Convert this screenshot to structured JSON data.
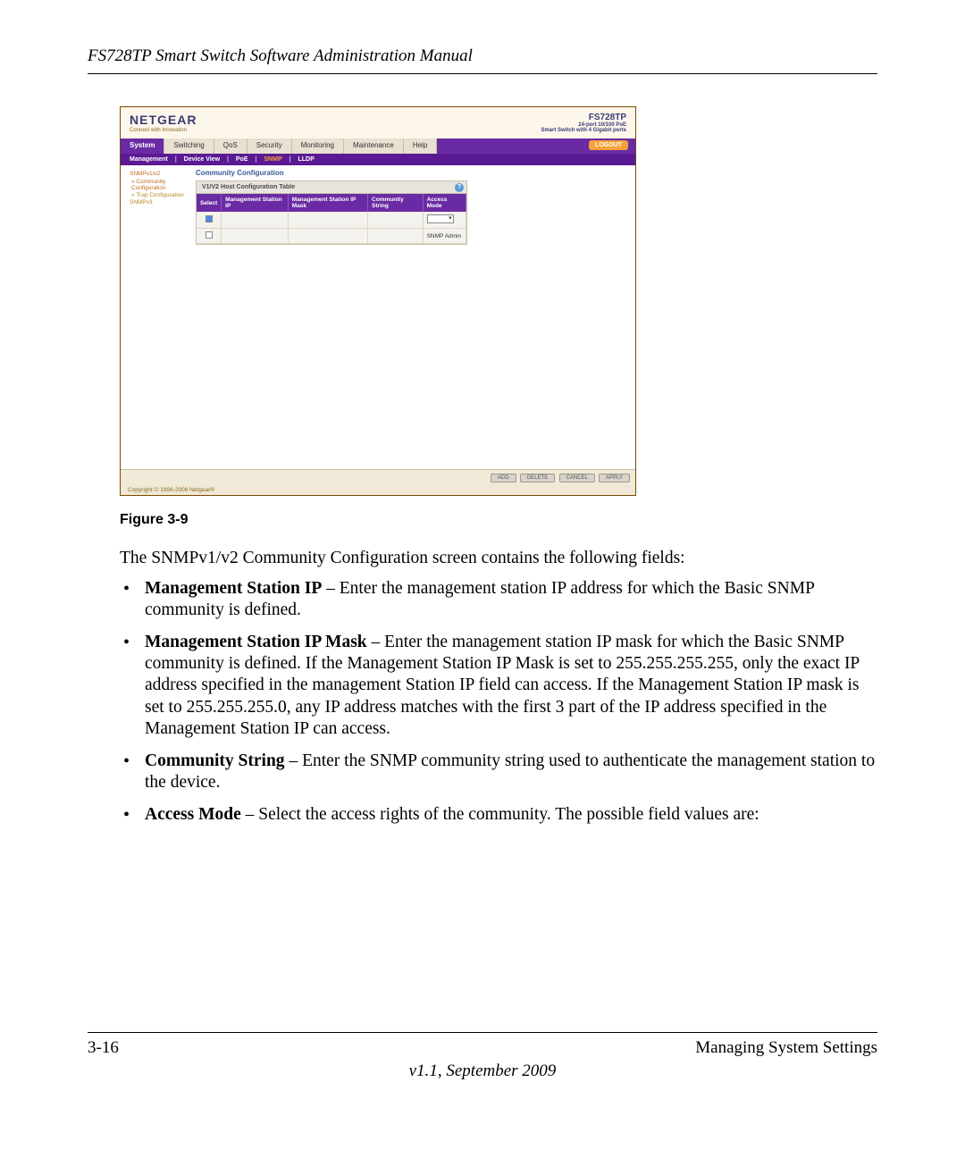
{
  "doc_header": "FS728TP Smart Switch Software Administration Manual",
  "screenshot": {
    "brand": "NETGEAR",
    "brand_tagline": "Connect with Innovation",
    "product_model": "FS728TP",
    "product_sub1": "24-port 10/100 PoE",
    "product_sub2": "Smart Switch with 4 Gigabit ports",
    "main_tabs": [
      "System",
      "Switching",
      "QoS",
      "Security",
      "Monitoring",
      "Maintenance",
      "Help"
    ],
    "main_tab_active": "System",
    "logout": "LOGOUT",
    "sub_tabs": [
      "Management",
      "Device View",
      "PoE",
      "SNMP",
      "LLDP"
    ],
    "sub_tab_active": "SNMP",
    "side_nav": {
      "group1": "SNMPv1/v2",
      "g1_items": [
        "Community Configuration",
        "Trap Configuration"
      ],
      "g1_active": "Community Configuration",
      "group2": "SNMPv3"
    },
    "panel_title": "Community Configuration",
    "panel_head": "V1/V2 Host Configuration Table",
    "table_headers": [
      "Select",
      "Management Station IP",
      "Management Station IP Mask",
      "Community String",
      "Access Mode"
    ],
    "row2_access_text": "SNMP Admin",
    "action_buttons": [
      "ADD",
      "DELETE",
      "CANCEL",
      "APPLY"
    ],
    "copyright": "Copyright © 1996-2008 Netgear®"
  },
  "figure_caption": "Figure 3-9",
  "intro_para": "The SNMPv1/v2 Community Configuration screen contains the following fields:",
  "bullets": [
    {
      "term": "Management Station IP",
      "desc": " – Enter the management station IP address for which the Basic SNMP community is defined."
    },
    {
      "term": "Management Station IP Mask",
      "desc": " – Enter the management station IP mask for which the Basic SNMP community is defined. If the Management Station IP Mask is set to 255.255.255.255, only the exact IP address specified in the management Station IP field can access.  If the Management Station IP mask is set to 255.255.255.0, any IP address matches with the first 3 part of the IP address specified in the Management Station IP can access."
    },
    {
      "term": "Community String",
      "desc": " – Enter the SNMP community string used to authenticate the management station to the device."
    },
    {
      "term": "Access Mode",
      "desc": " – Select the access rights of the community. The possible field values are:"
    }
  ],
  "footer": {
    "page_num": "3-16",
    "section": "Managing System Settings",
    "version": "v1.1, September 2009"
  }
}
